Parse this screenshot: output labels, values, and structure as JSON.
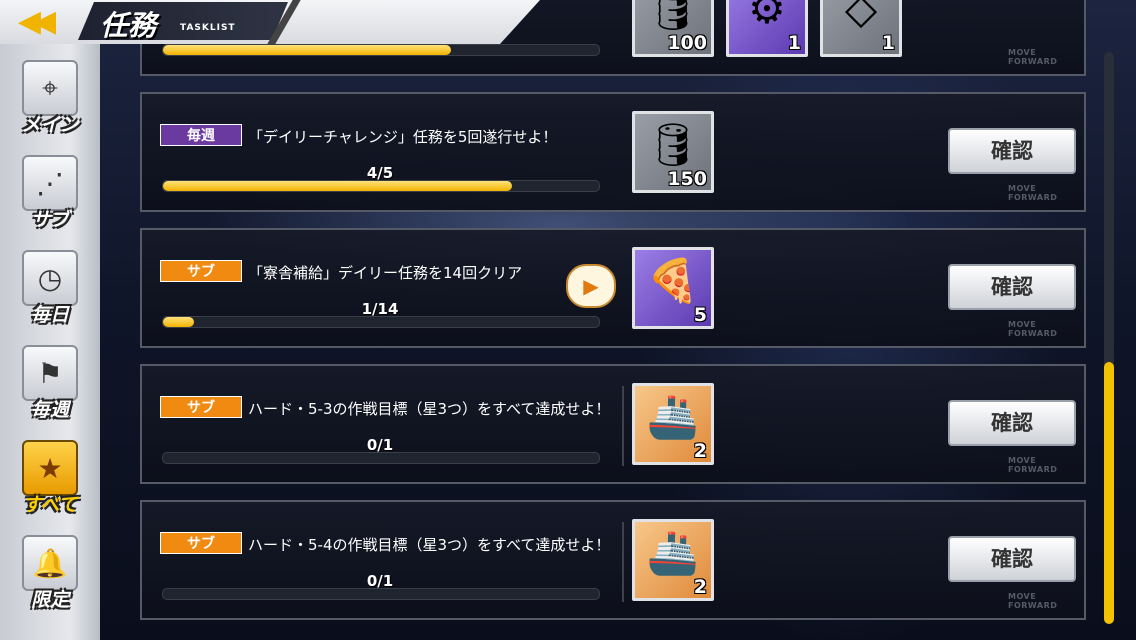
{
  "header": {
    "back_icon": "double-chevron-left-icon",
    "title": "任務",
    "subtitle": "TASKLIST"
  },
  "sidebar": {
    "items": [
      {
        "label": "メイン",
        "icon": "map-pin-icon",
        "active": false
      },
      {
        "label": "サブ",
        "icon": "route-icon",
        "active": false
      },
      {
        "label": "毎日",
        "icon": "clock-icon",
        "active": false
      },
      {
        "label": "毎週",
        "icon": "flag-icon",
        "active": false
      },
      {
        "label": "すべて",
        "icon": "calendar-star-icon",
        "active": true
      },
      {
        "label": "限定",
        "icon": "bell-icon",
        "active": false
      }
    ]
  },
  "tasks": [
    {
      "badge": "",
      "text": "",
      "progress_text": "",
      "progress": 0.66,
      "rewards": [
        {
          "count": "100",
          "icon": "oil-barrel-icon",
          "color": "gray"
        },
        {
          "count": "1",
          "icon": "drill-icon",
          "color": "purple"
        },
        {
          "count": "1",
          "icon": "gear-part-icon",
          "color": "gray"
        }
      ],
      "confirm": "確認",
      "move_forward": "MOVE FORWARD"
    },
    {
      "badge": "毎週",
      "badge_type": "weekly",
      "text": "「デイリーチャレンジ」任務を5回遂行せよ！",
      "progress_text": "4/5",
      "progress": 0.8,
      "rewards": [
        {
          "count": "150",
          "icon": "oil-barrel-icon",
          "color": "gray"
        }
      ],
      "confirm": "確認",
      "move_forward": "MOVE FORWARD"
    },
    {
      "badge": "サブ",
      "badge_type": "sub",
      "text": "「寮舎補給」デイリー任務を14回クリア",
      "progress_text": "1/14",
      "progress": 0.0714,
      "rewards": [
        {
          "count": "5",
          "icon": "pizza-icon",
          "color": "purple"
        }
      ],
      "has_video": true,
      "video_icon": "film-play-icon",
      "confirm": "確認",
      "move_forward": "MOVE FORWARD"
    },
    {
      "badge": "サブ",
      "badge_type": "sub",
      "text": "ハード・5-3の作戦目標（星3つ）をすべて達成せよ！",
      "progress_text": "0/1",
      "progress": 0,
      "rewards": [
        {
          "count": "2",
          "icon": "ship-blueprint-icon",
          "color": "gold"
        }
      ],
      "confirm": "確認",
      "move_forward": "MOVE FORWARD"
    },
    {
      "badge": "サブ",
      "badge_type": "sub",
      "text": "ハード・5-4の作戦目標（星3つ）をすべて達成せよ！",
      "progress_text": "0/1",
      "progress": 0,
      "rewards": [
        {
          "count": "2",
          "icon": "ship-blueprint-icon",
          "color": "gold"
        }
      ],
      "confirm": "確認",
      "move_forward": "MOVE FORWARD"
    }
  ],
  "scroll": {
    "position": 0.54,
    "visible_fraction": 0.46
  }
}
